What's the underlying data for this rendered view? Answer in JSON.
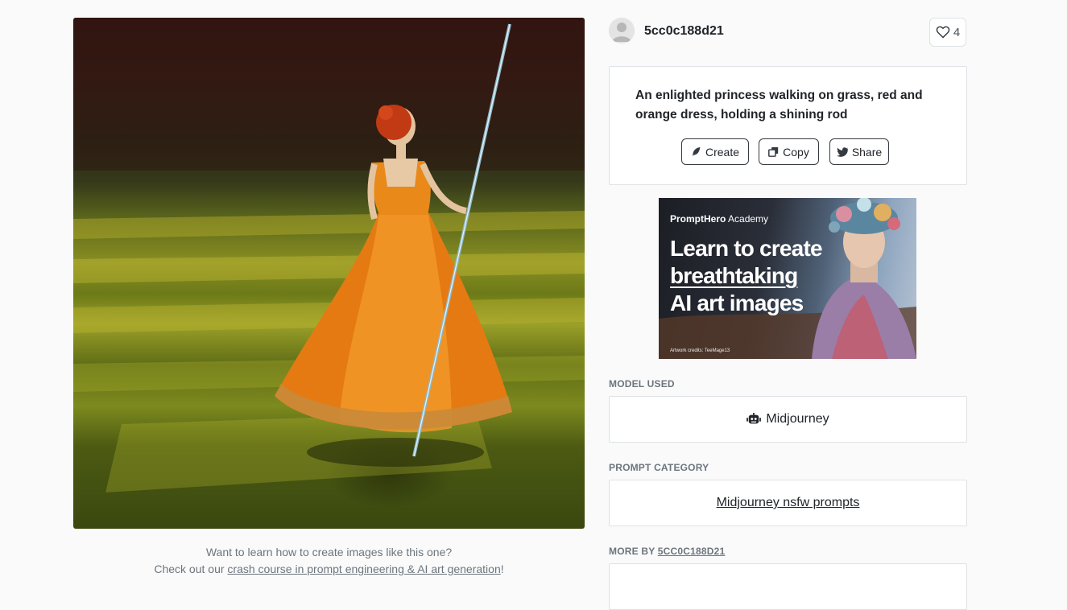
{
  "post": {
    "author": "5cc0c188d21",
    "likes": "4",
    "prompt": "An enlighted princess walking on grass, red and orange dress, holding a shining rod",
    "actions": {
      "create": "Create",
      "copy": "Copy",
      "share": "Share"
    }
  },
  "ad": {
    "brand_bold": "PromptHero",
    "brand_light": "Academy",
    "headline_1": "Learn to create",
    "headline_2": "breathtaking",
    "headline_3": "AI art images",
    "credit": "Artwork credits: TeeMage13"
  },
  "model": {
    "label": "MODEL USED",
    "value": "Midjourney",
    "icon": "robot-icon"
  },
  "category": {
    "label": "PROMPT CATEGORY",
    "value": "Midjourney nsfw prompts"
  },
  "more_by": {
    "label_prefix": "MORE BY",
    "author": "5CC0C188D21"
  },
  "caption": {
    "line1": "Want to learn how to create images like this one?",
    "line2_prefix": "Check out our",
    "link": "crash course in prompt engineering & AI art generation",
    "line2_suffix": "!"
  },
  "colors": {
    "accent_dark": "#212529",
    "muted": "#6c757d",
    "border": "#dee2e6",
    "background": "#fafafa"
  }
}
